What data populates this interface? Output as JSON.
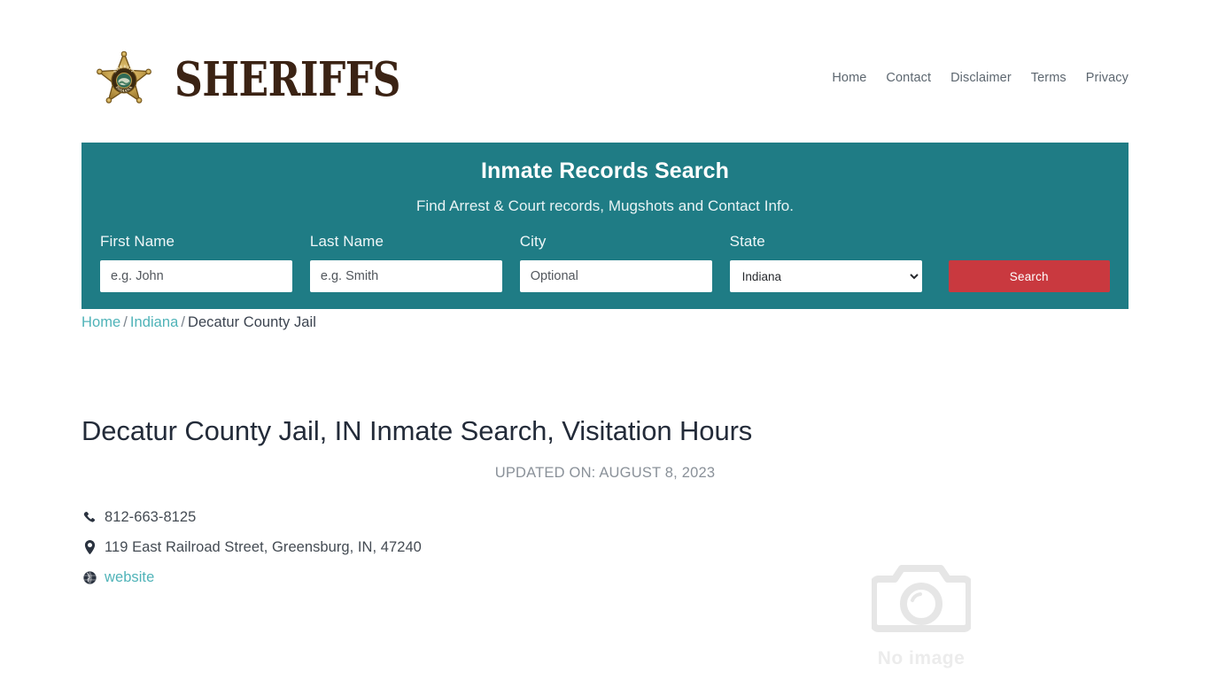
{
  "header": {
    "brand": {
      "logo_icon": "sheriff-star-badge-icon",
      "badge_top_text": "SHERIFF",
      "badge_bottom_text": "INDIANA",
      "wordmark": "SHERIFFS"
    },
    "nav": [
      {
        "label": "Home"
      },
      {
        "label": "Contact"
      },
      {
        "label": "Disclaimer"
      },
      {
        "label": "Terms"
      },
      {
        "label": "Privacy"
      }
    ]
  },
  "search_banner": {
    "title": "Inmate Records Search",
    "subtitle": "Find Arrest & Court records, Mugshots and Contact Info.",
    "background_color": "#1f7c85",
    "fields": {
      "first_name": {
        "label": "First Name",
        "value": "",
        "placeholder": "e.g. John"
      },
      "last_name": {
        "label": "Last Name",
        "value": "",
        "placeholder": "e.g. Smith"
      },
      "city": {
        "label": "City",
        "value": "",
        "placeholder": "Optional"
      },
      "state": {
        "label": "State",
        "selected": "Indiana",
        "options": [
          "Indiana"
        ]
      }
    },
    "search_button": {
      "label": "Search",
      "color": "#c9393f"
    }
  },
  "breadcrumb": {
    "items": [
      {
        "label": "Home",
        "is_link": true
      },
      {
        "label": "Indiana",
        "is_link": true
      },
      {
        "label": "Decatur County Jail",
        "is_link": false
      }
    ],
    "separator": "/",
    "link_color": "#4fb3b8"
  },
  "article": {
    "title": "Decatur County Jail, IN Inmate Search, Visitation Hours",
    "updated_on": "UPDATED ON: AUGUST 8, 2023",
    "contact": [
      {
        "icon": "phone-icon",
        "text": "812-663-8125",
        "is_link": false
      },
      {
        "icon": "map-pin-icon",
        "text": "119 East Railroad Street, Greensburg, IN, 47240",
        "is_link": false
      },
      {
        "icon": "globe-icon",
        "text": "website",
        "is_link": true
      }
    ]
  },
  "image_placeholder": {
    "icon": "camera-icon",
    "label": "No image",
    "color": "#ececec"
  }
}
